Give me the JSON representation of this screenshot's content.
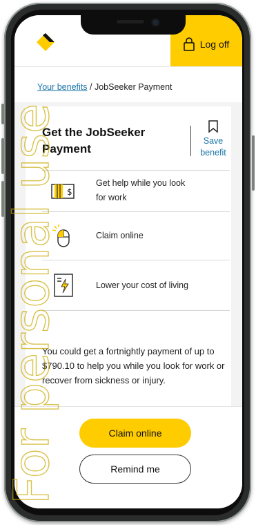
{
  "header": {
    "logout_label": "Log off",
    "brand_color": "#ffcc00"
  },
  "breadcrumb": {
    "parent": "Your benefits",
    "separator": "/",
    "current": "JobSeeker Payment"
  },
  "card": {
    "title": "Get the JobSeeker Payment",
    "save_label_line1": "Save",
    "save_label_line2": "benefit",
    "features": [
      {
        "icon": "money-icon",
        "label_line1": "Get help while you look",
        "label_line2": "for work"
      },
      {
        "icon": "mouse-click-icon",
        "label_line1": "Claim online",
        "label_line2": ""
      },
      {
        "icon": "energy-bill-icon",
        "label_line1": "Lower your cost of living",
        "label_line2": ""
      }
    ],
    "description": "You could get a fortnightly payment of up to $790.10 to help you while you look for work or recover from sickness or injury."
  },
  "actions": {
    "primary": "Claim online",
    "secondary": "Remind me"
  },
  "watermark": "For personal use"
}
